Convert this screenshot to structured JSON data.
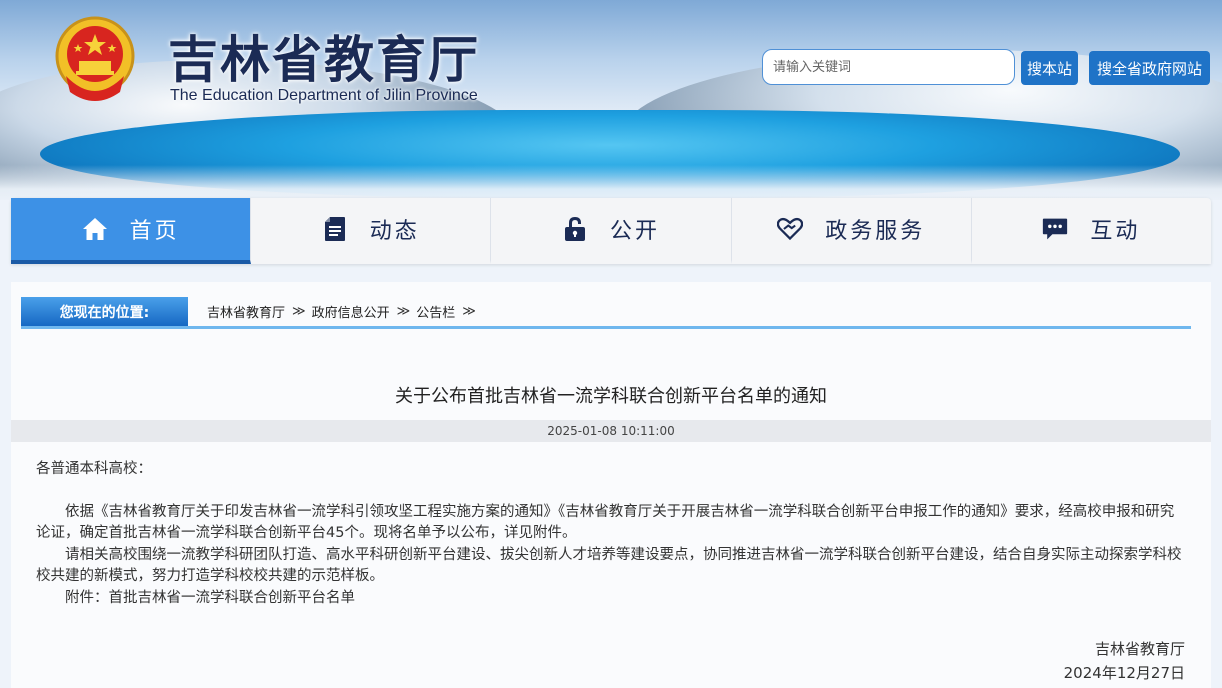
{
  "header": {
    "title": "吉林省教育厅",
    "subtitle": "The Education Department of Jilin Province",
    "search_placeholder": "请输入关键词",
    "search_site_label": "搜本站",
    "search_gov_label": "搜全省政府网站"
  },
  "nav": {
    "items": [
      {
        "label": "首页",
        "icon": "home-icon",
        "active": true
      },
      {
        "label": "动态",
        "icon": "document-icon",
        "active": false
      },
      {
        "label": "公开",
        "icon": "lock-icon",
        "active": false
      },
      {
        "label": "政务服务",
        "icon": "heart-hand-icon",
        "active": false
      },
      {
        "label": "互动",
        "icon": "chat-icon",
        "active": false
      }
    ]
  },
  "breadcrumb": {
    "label": "您现在的位置:",
    "items": [
      "吉林省教育厅",
      "政府信息公开",
      "公告栏"
    ],
    "separator": "≫"
  },
  "article": {
    "title": "关于公布首批吉林省一流学科联合创新平台名单的通知",
    "date": "2025-01-08 10:11:00",
    "salutation": "各普通本科高校：",
    "paragraphs": [
      "依据《吉林省教育厅关于印发吉林省一流学科引领攻坚工程实施方案的通知》《吉林省教育厅关于开展吉林省一流学科联合创新平台申报工作的通知》要求，经高校申报和研究论证，确定首批吉林省一流学科联合创新平台45个。现将名单予以公布，详见附件。",
      "请相关高校围绕一流教学科研团队打造、高水平科研创新平台建设、拔尖创新人才培养等建设要点，协同推进吉林省一流学科联合创新平台建设，结合自身实际主动探索学科校校共建的新模式，努力打造学科校校共建的示范样板。",
      "附件：首批吉林省一流学科联合创新平台名单"
    ],
    "signature": "吉林省教育厅",
    "sign_date": "2024年12月27日"
  },
  "colors": {
    "brand_blue": "#1f73c7",
    "nav_active": "#3d91e6",
    "title_navy": "#1b2b55"
  }
}
